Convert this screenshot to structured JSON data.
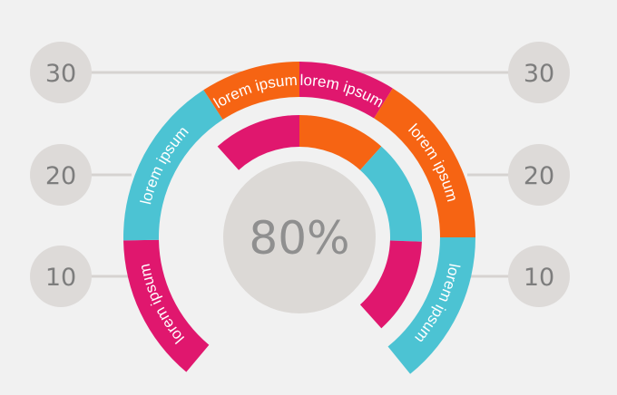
{
  "center": {
    "value_text": "80%"
  },
  "scale": {
    "left": [
      "30",
      "20",
      "10"
    ],
    "right": [
      "30",
      "20",
      "10"
    ]
  },
  "outer_ring": {
    "segments": [
      {
        "label": "lorem ipsum",
        "color": "#e0176e"
      },
      {
        "label": "lorem ipsum",
        "color": "#4cc3d3"
      },
      {
        "label": "lorem ipsum",
        "color": "#f66413"
      },
      {
        "label": "lorem ipsum",
        "color": "#e0176e"
      },
      {
        "label": "lorem ipsum",
        "color": "#f66413"
      },
      {
        "label": "lorem ipsum",
        "color": "#4cc3d3"
      }
    ]
  },
  "inner_ring": {
    "segments": [
      {
        "color": "#e0176e"
      },
      {
        "color": "#f66413"
      },
      {
        "color": "#4cc3d3"
      },
      {
        "color": "#e0176e"
      }
    ]
  },
  "colors": {
    "background": "#f1f1f1",
    "scale_circle": "#dddad8",
    "scale_text": "#7d7d7d",
    "scale_line": "#d6d3d1",
    "center_circle": "#dcd9d6",
    "center_text": "#8f8f8f",
    "label_text": "#ffffff"
  }
}
